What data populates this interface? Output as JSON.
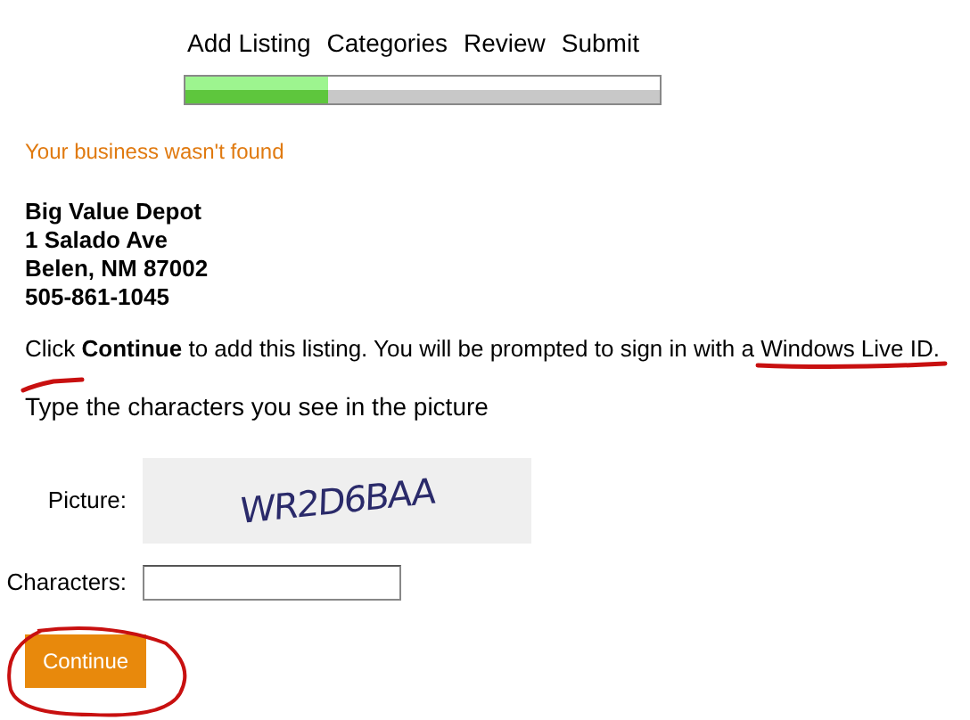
{
  "steps": [
    "Add Listing",
    "Categories",
    "Review",
    "Submit"
  ],
  "progress": {
    "level": 0.3
  },
  "notice": "Your business wasn't found",
  "address": [
    "Big Value Depot",
    "1 Salado Ave",
    "Belen, NM 87002",
    "505-861-1045"
  ],
  "instructions": "Click **Continue** to add this listing. You will be prompted to sign in with a Windows Live ID.",
  "captcha": {
    "heading": "Type the characters you see in the picture",
    "picture_label": "Picture:",
    "picture_text": "WR2D6BAA",
    "characters_label": "Characters:"
  },
  "continue_button": "Continue"
}
